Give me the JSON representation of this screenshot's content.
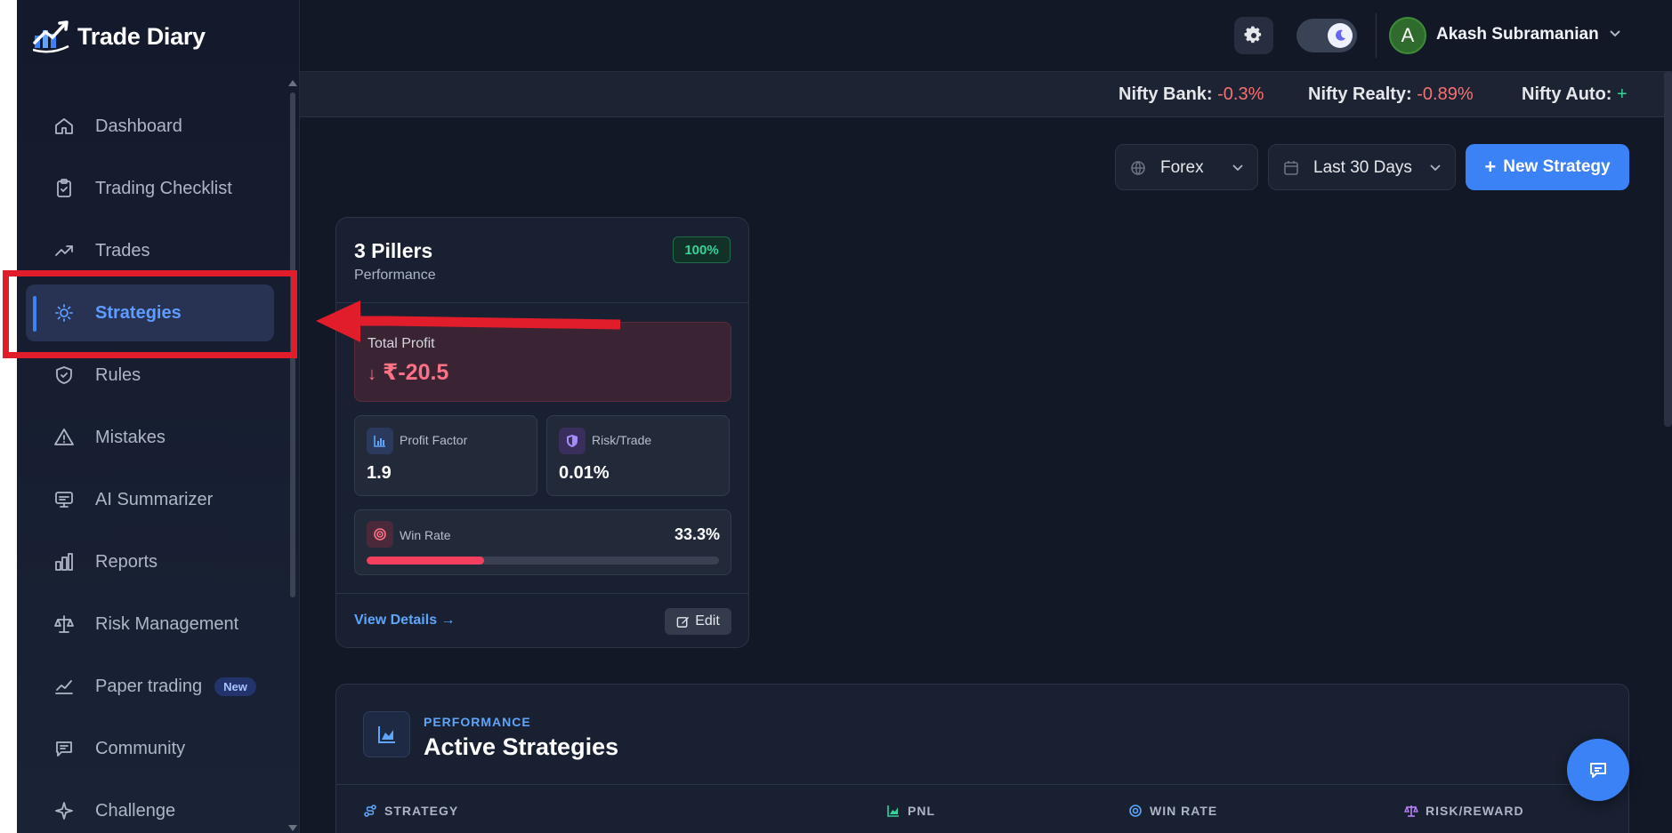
{
  "app": {
    "name": "Trade Diary"
  },
  "sidebar": {
    "items": [
      {
        "label": "Dashboard",
        "icon": "home-icon"
      },
      {
        "label": "Trading Checklist",
        "icon": "clipboard-check-icon"
      },
      {
        "label": "Trades",
        "icon": "trending-up-icon"
      },
      {
        "label": "Strategies",
        "icon": "lightbulb-icon",
        "active": true
      },
      {
        "label": "Rules",
        "icon": "shield-check-icon"
      },
      {
        "label": "Mistakes",
        "icon": "warning-triangle-icon"
      },
      {
        "label": "AI Summarizer",
        "icon": "monitor-icon"
      },
      {
        "label": "Reports",
        "icon": "bar-chart-icon"
      },
      {
        "label": "Risk Management",
        "icon": "scale-icon"
      },
      {
        "label": "Paper trading",
        "icon": "line-chart-icon",
        "badge": "New"
      },
      {
        "label": "Community",
        "icon": "message-square-icon"
      },
      {
        "label": "Challenge",
        "icon": "sparkle-icon"
      }
    ]
  },
  "header": {
    "user": {
      "initial": "A",
      "name": "Akash Subramanian"
    }
  },
  "ticker": [
    {
      "name": "Nifty Bank:",
      "change": "-0.3%",
      "direction": "down"
    },
    {
      "name": "Nifty Realty:",
      "change": "-0.89%",
      "direction": "down"
    },
    {
      "name": "Nifty Auto:",
      "change": "+",
      "direction": "up"
    }
  ],
  "filters": {
    "market": "Forex",
    "range": "Last 30 Days",
    "new_button": "New Strategy"
  },
  "strategy_card": {
    "title": "3 Pillers",
    "subtitle": "Performance",
    "badge": "100%",
    "total_profit_label": "Total Profit",
    "total_profit_value": "₹-20.5",
    "profit_factor_label": "Profit Factor",
    "profit_factor_value": "1.9",
    "risk_trade_label": "Risk/Trade",
    "risk_trade_value": "0.01%",
    "win_rate_label": "Win Rate",
    "win_rate_value": "33.3%",
    "win_rate_fraction": 0.333,
    "view_details": "View Details",
    "edit": "Edit"
  },
  "active_strategies": {
    "kicker": "PERFORMANCE",
    "title": "Active Strategies",
    "columns": [
      "STRATEGY",
      "PNL",
      "WIN RATE",
      "RISK/REWARD"
    ]
  },
  "colors": {
    "accent": "#3b82f6",
    "negative": "#f87171",
    "positive": "#34d399",
    "highlight": "#e11d2b"
  }
}
